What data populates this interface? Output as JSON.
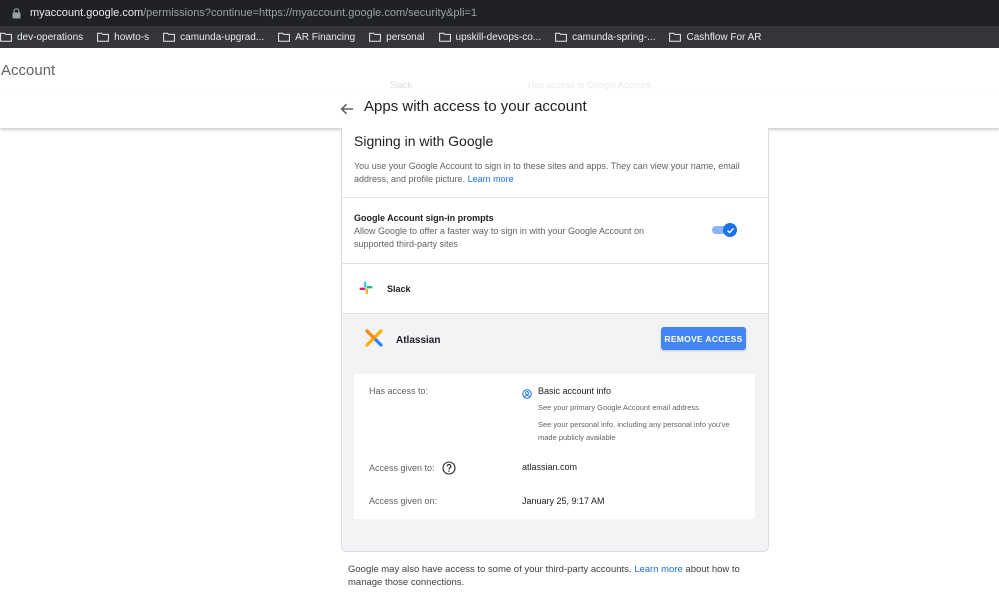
{
  "browser": {
    "url_host": "myaccount.google.com",
    "url_path": "/permissions?continue=https://myaccount.google.com/security&pli=1",
    "bookmarks": [
      "dev-operations",
      "howto-s",
      "camunda-upgrad...",
      "AR Financing",
      "personal",
      "upskill-devops-co...",
      "camunda-spring-...",
      "Cashflow For AR"
    ]
  },
  "header": {
    "account_title": "Account",
    "faded_app": "Slack",
    "faded_desc": "Has access to Google Account",
    "page_heading": "Apps with access to your account"
  },
  "signin": {
    "title": "Signing in with Google",
    "desc": "You use your Google Account to sign in to these sites and apps. They can view your name, email address, and profile picture.",
    "learn_more": "Learn more"
  },
  "prompts": {
    "title": "Google Account sign-in prompts",
    "desc": "Allow Google to offer a faster way to sign in with your Google Account on supported third-party sites",
    "toggle_on": true
  },
  "apps": {
    "slack": {
      "name": "Slack"
    },
    "atlassian": {
      "name": "Atlassian",
      "remove_label": "REMOVE ACCESS",
      "has_access_label": "Has access to:",
      "basic_info": "Basic account info",
      "primary_email": "See your primary Google Account email address",
      "personal_info": "See your personal info, including any personal info you've made publicly available",
      "access_given_to_label": "Access given to:",
      "access_given_to": "atlassian.com",
      "access_given_on_label": "Access given on:",
      "access_given_on": "January 25, 9:17 AM"
    }
  },
  "footer": {
    "note_before": "Google may also have access to some of your third-party accounts.",
    "learn_more": "Learn more",
    "note_after": "about how to manage those connections."
  },
  "colors": {
    "accent": "#1a73e8",
    "button": "#4285f4",
    "section_bg": "#f1f3f4"
  }
}
